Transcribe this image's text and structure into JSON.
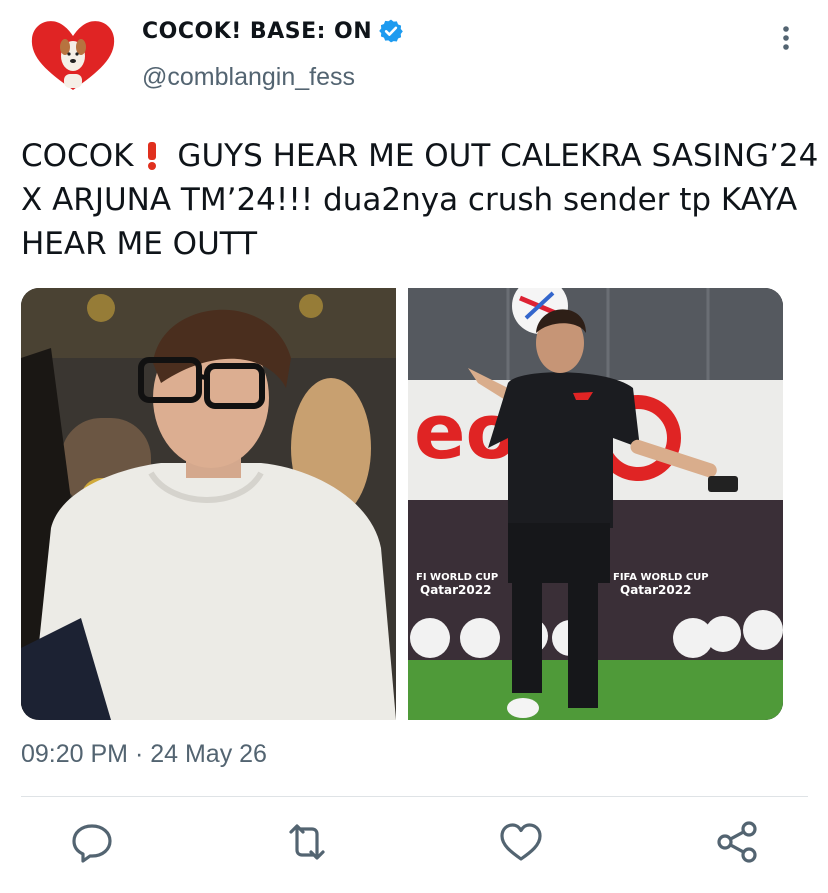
{
  "tweet": {
    "display_name": "COCOK! BASE: ON",
    "handle": "@comblangin_fess",
    "text_prefix": "COCOK",
    "text_body": "GUYS HEAR ME OUT CALEKRA SASING’24 X ARJUNA TM’24!!! dua2nya crush sender tp KAYA HEAR ME OUTT",
    "timestamp": "09:20 PM · 24 May 26"
  },
  "media": {
    "photo_right": {
      "banner_text": "eo",
      "logo_left_line1": "FI WORLD CUP",
      "logo_left_line2": "Qatar2022",
      "logo_right_line1": "FIFA WORLD CUP",
      "logo_right_line2": "Qatar2022"
    }
  },
  "icons": {
    "avatar": "heart-dog-avatar",
    "verified": "verified-badge-icon",
    "more": "more-vertical-icon",
    "reply": "reply-icon",
    "retweet": "retweet-icon",
    "like": "heart-icon",
    "share": "share-icon"
  },
  "colors": {
    "accent": "#1d9bf0",
    "icon_gray": "#536471",
    "heart_red": "#e02424",
    "exclamation_red": "#e0301e"
  }
}
